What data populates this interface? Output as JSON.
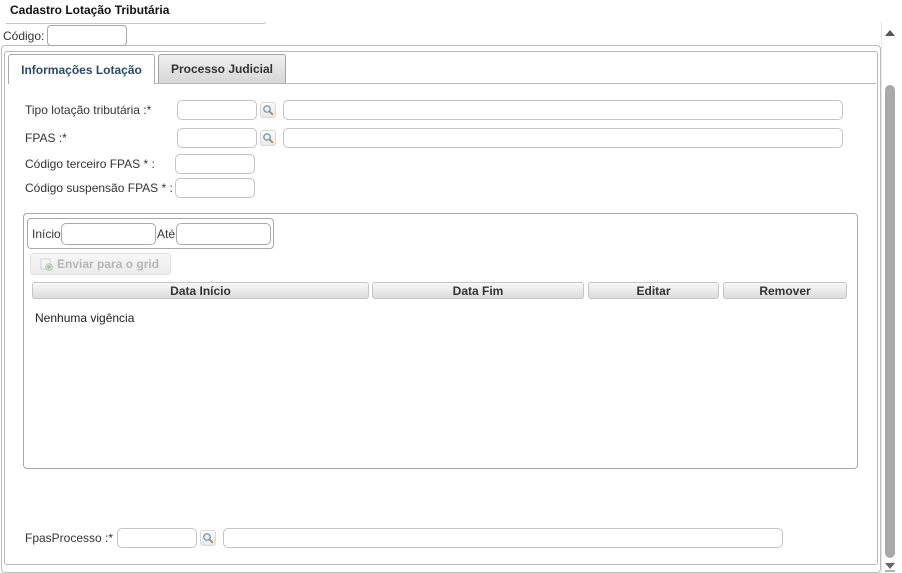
{
  "window": {
    "title": "Cadastro Lotação Tributária"
  },
  "codigo": {
    "label": "Código:",
    "value": ""
  },
  "tabs": [
    {
      "label": "Informações Lotação",
      "active": true
    },
    {
      "label": "Processo Judicial",
      "active": false
    }
  ],
  "form": {
    "tipo_lotacao": {
      "label": "Tipo lotação tributária :*",
      "code": "",
      "description": "",
      "lookup_icon": "search-icon"
    },
    "fpas": {
      "label": "FPAS :*",
      "code": "",
      "description": "",
      "lookup_icon": "search-icon"
    },
    "codigo_terceiro": {
      "label": "Código terceiro FPAS * :",
      "value": ""
    },
    "codigo_suspensao": {
      "label": "Código suspensão FPAS * :",
      "value": ""
    }
  },
  "vigencia": {
    "inicio_label": "Início",
    "ate_label": "Até",
    "inicio_value": "",
    "ate_value": "",
    "send_button": "Enviar para o grid",
    "columns": [
      "Data Início",
      "Data Fim",
      "Editar",
      "Remover"
    ],
    "empty_message": "Nenhuma vigência"
  },
  "fpas_processo": {
    "label": "FpasProcesso :*",
    "code": "",
    "description": "",
    "lookup_icon": "search-icon"
  },
  "colors": {
    "accent_tab_text": "#2a4a68",
    "border": "#a9a9a9",
    "scroll_thumb": "#a9a9a9"
  }
}
